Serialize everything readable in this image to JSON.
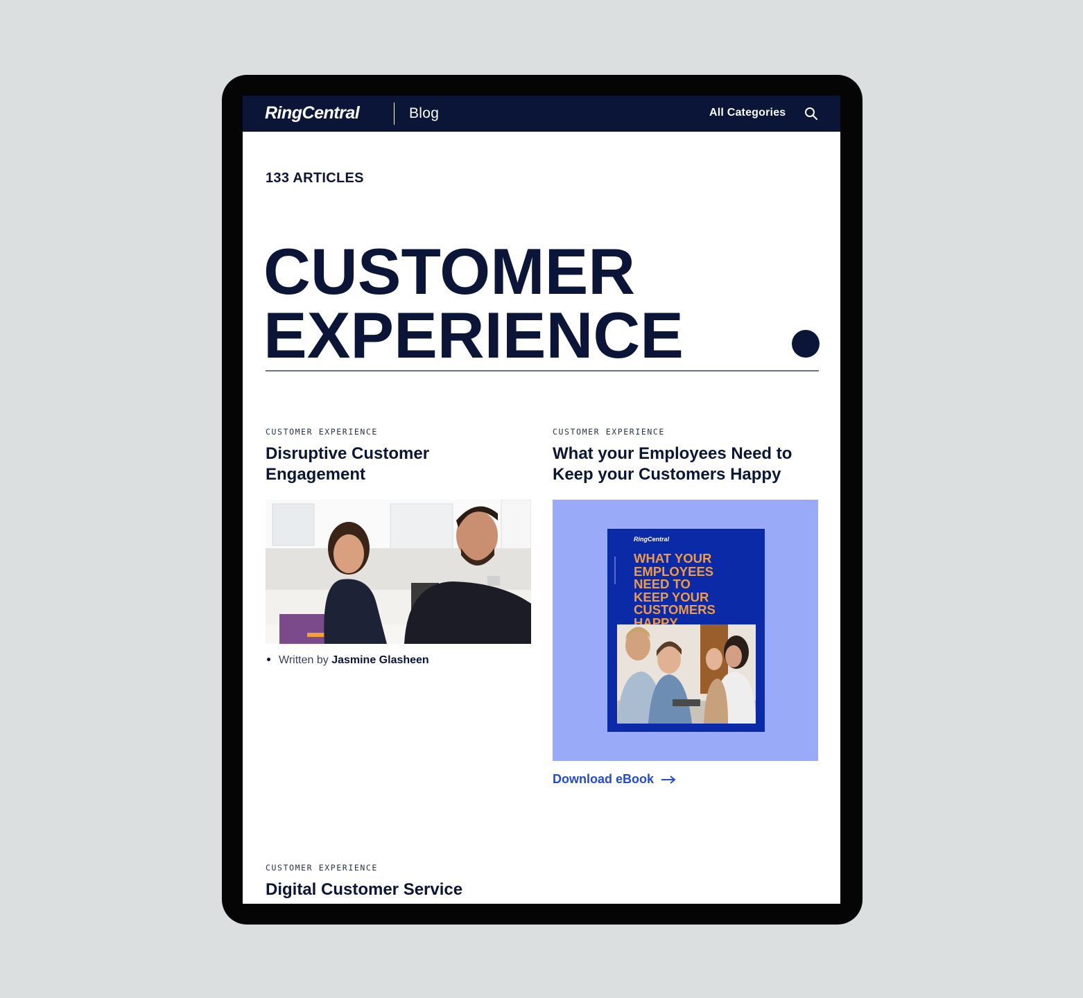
{
  "navbar": {
    "brand": "RingCentral",
    "section": "Blog",
    "all_categories": "All Categories",
    "search_icon": "search-icon",
    "bg_color": "#0b1538"
  },
  "header": {
    "article_count": "133 ARTICLES",
    "title_line1": "CUSTOMER",
    "title_line2": "EXPERIENCE"
  },
  "cards": [
    {
      "tag": "CUSTOMER EXPERIENCE",
      "title_line1": "Disruptive Customer",
      "title_line2": "Engagement",
      "byline_prefix": "Written by",
      "author": "Jasmine Glasheen"
    },
    {
      "tag": "CUSTOMER EXPERIENCE",
      "title_line1": "What your Employees Need to",
      "title_line2": "Keep your Customers Happy",
      "ebook_brand": "RingCentral",
      "ebook_title_lines": [
        "WHAT YOUR",
        "EMPLOYEES",
        "NEED TO",
        "KEEP YOUR",
        "CUSTOMERS",
        "HAPPY"
      ],
      "cta": "Download eBook",
      "cta_color": "#2249d6",
      "panel_color": "#98aaf8"
    },
    {
      "tag": "CUSTOMER EXPERIENCE",
      "title_line1": "Digital Customer Service"
    }
  ]
}
